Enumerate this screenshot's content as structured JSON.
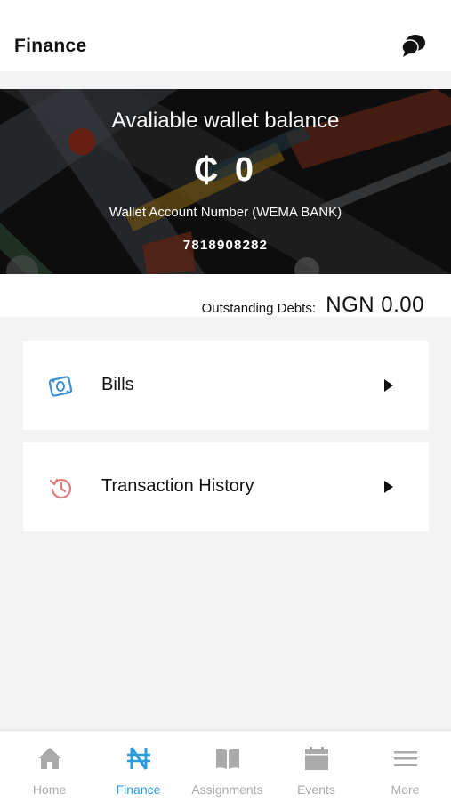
{
  "header": {
    "title": "Finance",
    "chat_icon": "chat-bubbles-icon"
  },
  "wallet": {
    "balance_label": "Avaliable wallet balance",
    "balance_value": "₵ 0",
    "account_label": "Wallet Account Number (WEMA BANK)",
    "account_number": "7818908282"
  },
  "debts": {
    "label": "Outstanding Debts:",
    "value": "NGN 0.00"
  },
  "menu": [
    {
      "label": "Bills",
      "icon": "money-icon",
      "icon_color": "#3a8fd8"
    },
    {
      "label": "Transaction History",
      "icon": "history-icon",
      "icon_color": "#e07a7a"
    }
  ],
  "tabs": [
    {
      "label": "Home",
      "icon": "home-icon",
      "active": false
    },
    {
      "label": "Finance",
      "icon": "naira-icon",
      "active": true
    },
    {
      "label": "Assignments",
      "icon": "book-icon",
      "active": false
    },
    {
      "label": "Events",
      "icon": "calendar-icon",
      "active": false
    },
    {
      "label": "More",
      "icon": "menu-icon",
      "active": false
    }
  ],
  "colors": {
    "accent": "#2b9be0",
    "inactive": "#aaaaaa",
    "hero_bg": "#101010"
  }
}
